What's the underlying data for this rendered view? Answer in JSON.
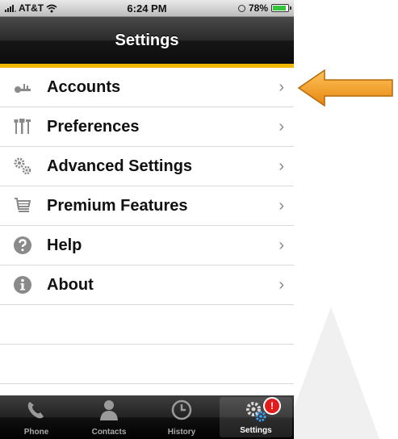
{
  "status_bar": {
    "carrier": "AT&T",
    "time": "6:24 PM",
    "battery": "78%"
  },
  "nav": {
    "title": "Settings"
  },
  "colors": {
    "accent": "#f0b800",
    "badge": "#e21b1b",
    "arrow": "#f29a1f"
  },
  "list": [
    {
      "label": "Accounts",
      "icon": "key-icon"
    },
    {
      "label": "Preferences",
      "icon": "tools-icon"
    },
    {
      "label": "Advanced Settings",
      "icon": "gears-icon"
    },
    {
      "label": "Premium Features",
      "icon": "cart-icon"
    },
    {
      "label": "Help",
      "icon": "help-icon"
    },
    {
      "label": "About",
      "icon": "info-icon"
    }
  ],
  "tabs": [
    {
      "label": "Phone",
      "icon": "phone-icon"
    },
    {
      "label": "Contacts",
      "icon": "contact-icon"
    },
    {
      "label": "History",
      "icon": "clock-icon"
    },
    {
      "label": "Settings",
      "icon": "settings-gear-icon",
      "badge": "!"
    }
  ]
}
